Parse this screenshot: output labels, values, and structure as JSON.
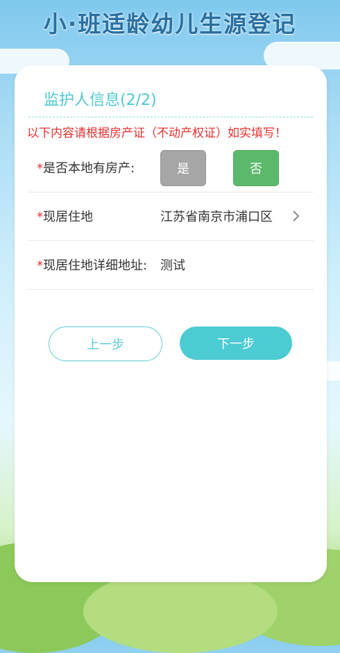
{
  "app": {
    "title": "小·班适龄幼儿生源登记"
  },
  "section": {
    "title": "监护人信息(2/2)"
  },
  "notice": "以下内容请根据房产证（不动产权证）如实填写！",
  "form": {
    "required_mark": "*",
    "has_property": {
      "label": "是否本地有房产:",
      "yes_label": "是",
      "no_label": "否",
      "selected": "否"
    },
    "residence": {
      "label": "现居住地",
      "value": "江苏省南京市浦口区"
    },
    "address_detail": {
      "label": "现居住地详细地址:",
      "value": "测试"
    }
  },
  "nav": {
    "prev_label": "上一步",
    "next_label": "下一步"
  },
  "colors": {
    "accent": "#4ccbd2",
    "required": "#e53030",
    "no_selected": "#5cb96b",
    "yes_unselected": "#a6a6a6"
  },
  "icons": {
    "residence_arrow": "chevron-right-icon"
  }
}
